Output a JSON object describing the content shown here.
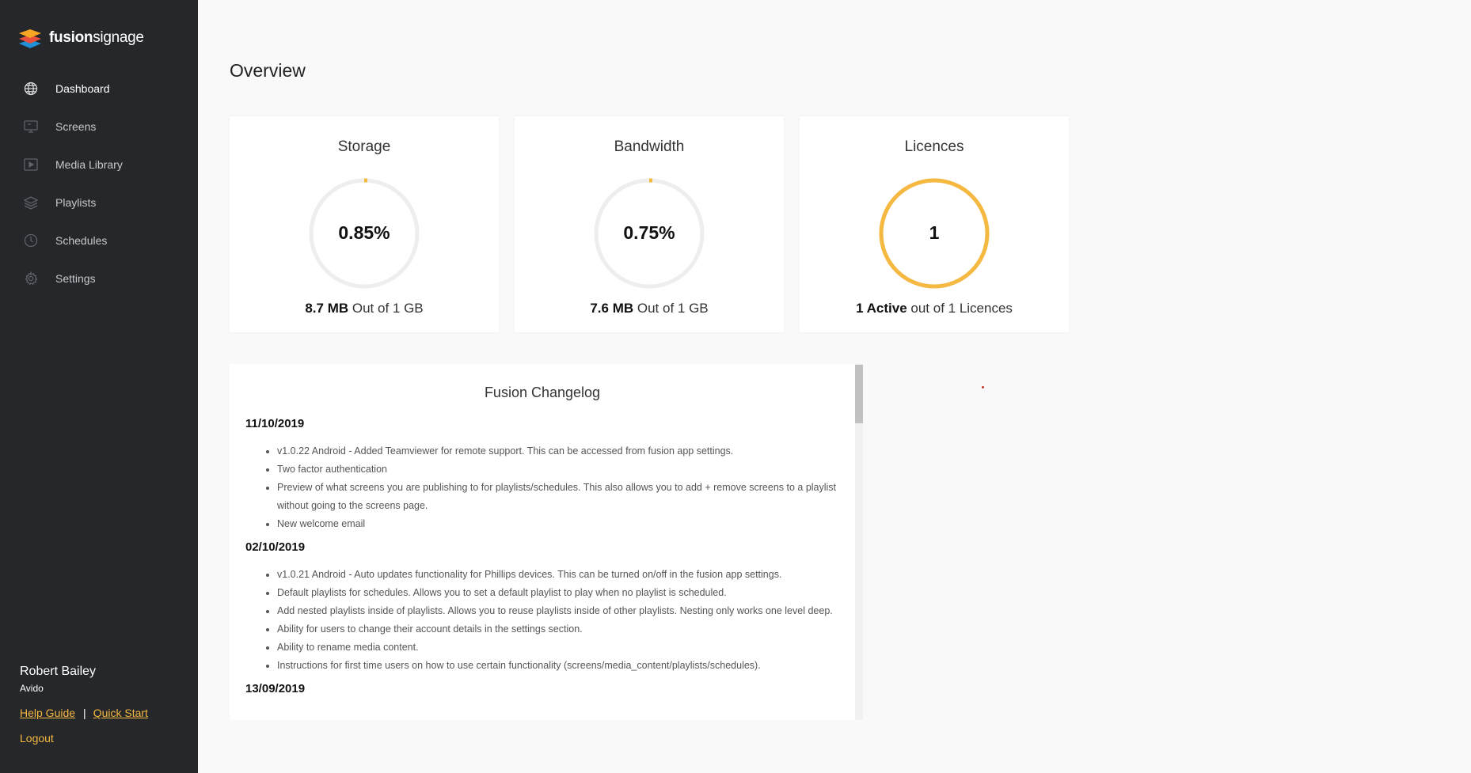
{
  "brand": {
    "logo_bold": "fusion",
    "logo_light": "signage"
  },
  "sidebar": {
    "items": [
      {
        "label": "Dashboard",
        "icon": "globe-icon",
        "active": true
      },
      {
        "label": "Screens",
        "icon": "monitor-icon",
        "active": false
      },
      {
        "label": "Media Library",
        "icon": "play-icon",
        "active": false
      },
      {
        "label": "Playlists",
        "icon": "layers-icon",
        "active": false
      },
      {
        "label": "Schedules",
        "icon": "clock-icon",
        "active": false
      },
      {
        "label": "Settings",
        "icon": "gear-icon",
        "active": false
      }
    ]
  },
  "user": {
    "name": "Robert Bailey",
    "org": "Avido",
    "help_guide": "Help Guide",
    "separator": "|",
    "quick_start": "Quick Start",
    "logout": "Logout"
  },
  "main": {
    "title": "Overview",
    "cards": [
      {
        "title": "Storage",
        "value": "0.85%",
        "bold": "8.7 MB",
        "rest": " Out of 1 GB",
        "fill": 0.0085
      },
      {
        "title": "Bandwidth",
        "value": "0.75%",
        "bold": "7.6 MB",
        "rest": " Out of 1 GB",
        "fill": 0.0075
      },
      {
        "title": "Licences",
        "value": "1",
        "bold": "1 Active",
        "rest": " out of 1 Licences",
        "fill": 1.0
      }
    ],
    "changelog": {
      "title": "Fusion Changelog",
      "entries": [
        {
          "date": "11/10/2019",
          "items": [
            "v1.0.22 Android - Added Teamviewer for remote support. This can be accessed from fusion app settings.",
            "Two factor authentication",
            "Preview of what screens you are publishing to for playlists/schedules. This also allows you to add + remove screens to a playlist without going to the screens page.",
            "New welcome email"
          ]
        },
        {
          "date": "02/10/2019",
          "items": [
            "v1.0.21 Android - Auto updates functionality for Phillips devices. This can be turned on/off in the fusion app settings.",
            "Default playlists for schedules. Allows you to set a default playlist to play when no playlist is scheduled.",
            "Add nested playlists inside of playlists. Allows you to reuse playlists inside of other playlists. Nesting only works one level deep.",
            "Ability for users to change their account details in the settings section.",
            "Ability to rename media content.",
            "Instructions for first time users on how to use certain functionality (screens/media_content/playlists/schedules)."
          ]
        },
        {
          "date": "13/09/2019",
          "items": []
        }
      ]
    }
  },
  "colors": {
    "sidebar_bg": "#25272b",
    "accent": "#f5b841",
    "ring_track": "#eeeeee"
  }
}
